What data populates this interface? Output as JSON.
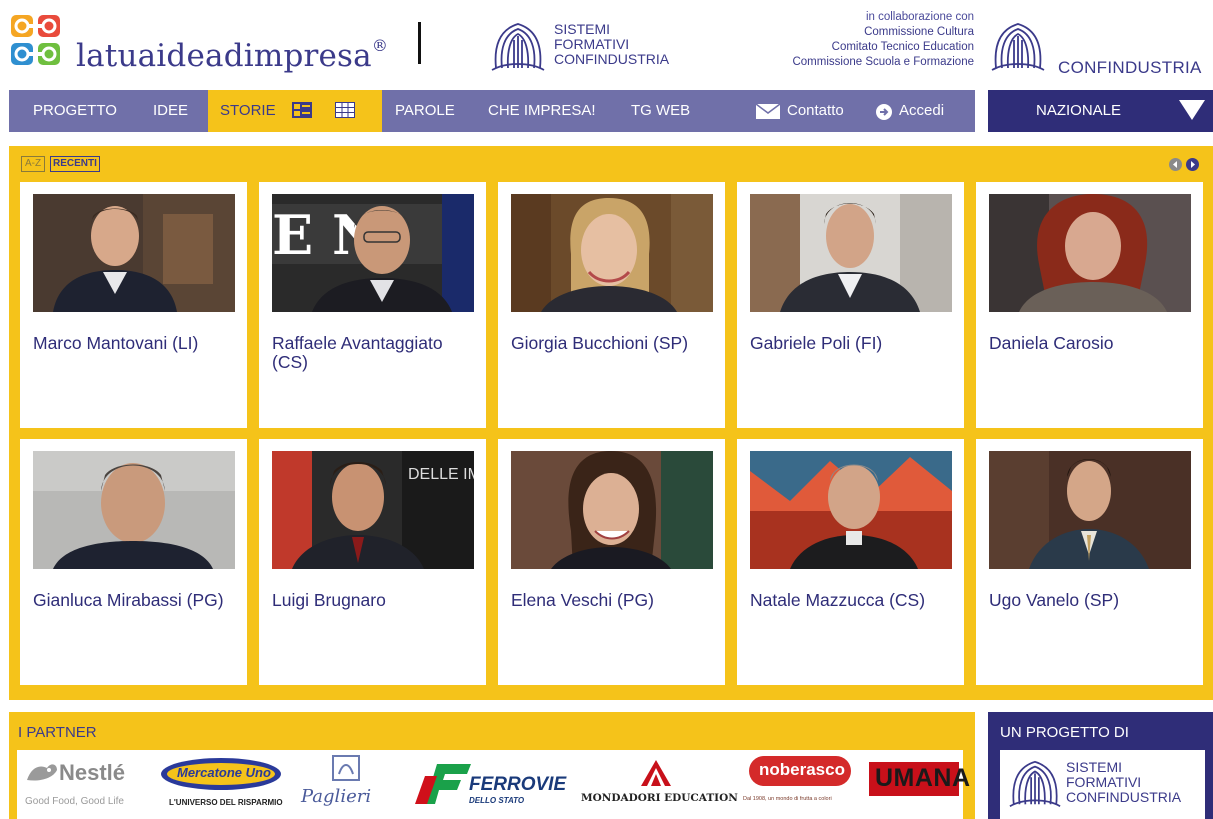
{
  "header": {
    "logo_text": "latuaideadimpresa",
    "logo_reg": "®",
    "sfc_lines": [
      "SISTEMI",
      "FORMATIVI",
      "CONFINDUSTRIA"
    ],
    "collab_lines": [
      "in collaborazione con",
      "Commissione Cultura",
      "Comitato Tecnico Education",
      "Commissione Scuola e Formazione"
    ],
    "confindustria": "CONFINDUSTRIA"
  },
  "nav": {
    "progetto": "PROGETTO",
    "idee": "IDEE",
    "storie": "STORIE",
    "parole": "PAROLE",
    "che_impresa": "CHE IMPRESA!",
    "tg_web": "TG WEB",
    "contatto": "Contatto",
    "accedi": "Accedi",
    "region": "NAZIONALE"
  },
  "gallery": {
    "sort_az": "A-Z",
    "sort_recent": "RECENTI",
    "cards": [
      {
        "name": "Marco Mantovani (LI)"
      },
      {
        "name": "Raffaele Avantaggiato (CS)"
      },
      {
        "name": "Giorgia Bucchioni (SP)"
      },
      {
        "name": "Gabriele Poli (FI)"
      },
      {
        "name": "Daniela Carosio"
      },
      {
        "name": "Gianluca Mirabassi (PG)"
      },
      {
        "name": "Luigi Brugnaro"
      },
      {
        "name": "Elena Veschi (PG)"
      },
      {
        "name": "Natale Mazzucca (CS)"
      },
      {
        "name": "Ugo Vanelo (SP)"
      }
    ]
  },
  "footer": {
    "partners_title": "I PARTNER",
    "partners": {
      "nestle": "Nestlé",
      "nestle_tag": "Good Food, Good Life",
      "mercatone": "Mercatone Uno",
      "mercatone_tag": "L'UNIVERSO DEL RISPARMIO",
      "paglieri": "Paglieri",
      "ferrovie": "FERROVIE",
      "ferrovie_tag": "DELLO STATO",
      "mondadori": "MONDADORI EDUCATION",
      "noberasco": "noberasco",
      "noberasco_tag": "Dal 1908, un mondo di frutta a colori",
      "umana": "UMANA"
    },
    "project_title": "UN PROGETTO DI",
    "project_lines": [
      "SISTEMI",
      "FORMATIVI",
      "CONFINDUSTRIA"
    ]
  },
  "colors": {
    "nav_bg": "#7070a9",
    "accent_yellow": "#f5c31a",
    "dark_blue": "#2f2d78",
    "text_blue": "#3b3a8a"
  }
}
